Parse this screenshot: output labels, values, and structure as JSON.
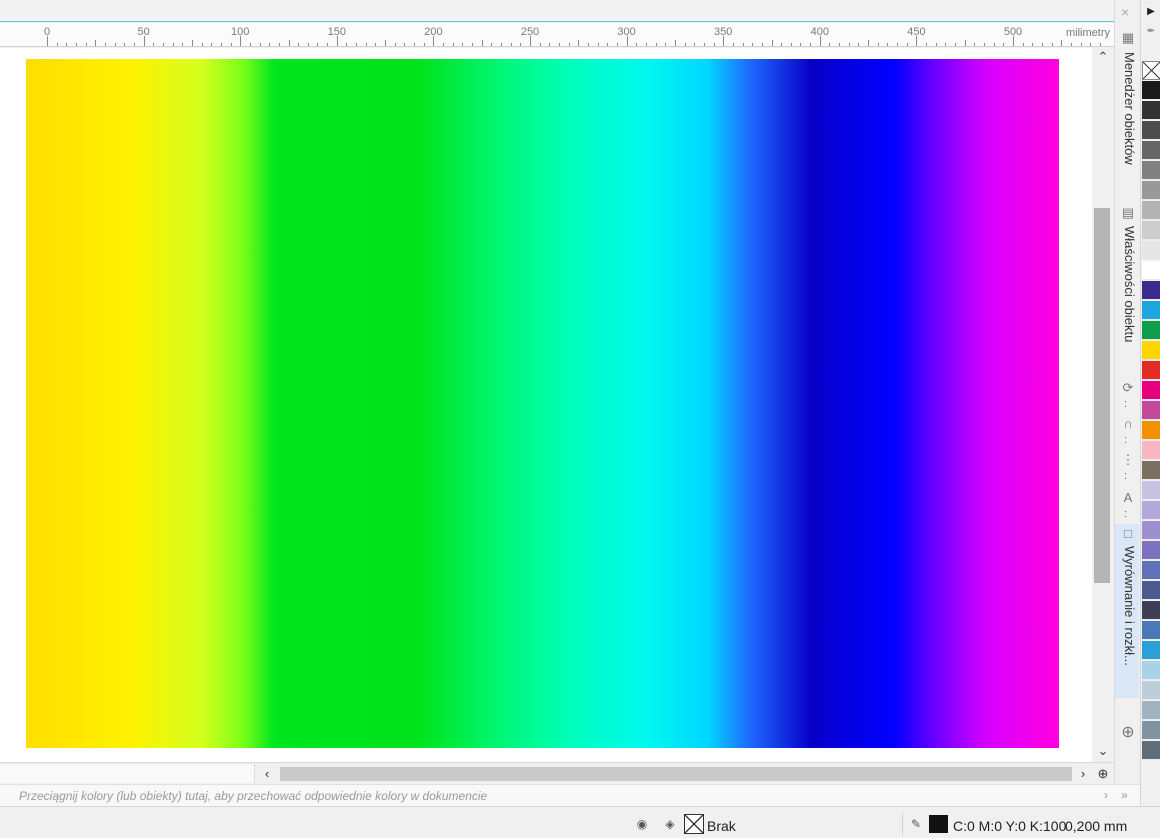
{
  "ruler": {
    "labels": [
      "0",
      "50",
      "100",
      "150",
      "200",
      "250",
      "300",
      "350",
      "400",
      "450",
      "500"
    ],
    "unit": "milimetry"
  },
  "docker": {
    "tabs": [
      "Menedżer obiektów",
      "Właściwości obiektu",
      "Wyrównanie i rozkł..."
    ],
    "icons": [
      "transform-icon",
      "shaping-icon",
      "dimension-icon",
      "text-icon",
      "align-icon",
      "add-docker-icon"
    ]
  },
  "dropzone": {
    "hint": "Przeciągnij kolory (lub obiekty) tutaj, aby przechować odpowiednie kolory w dokumencie"
  },
  "status": {
    "fill_label": "Brak",
    "outline_label": "C:0 M:0 Y:0 K:100",
    "outline_width": "0,200 mm"
  },
  "palette": {
    "colors": [
      "#1a1a1a",
      "#333333",
      "#4d4d4d",
      "#666666",
      "#808080",
      "#999999",
      "#b3b3b3",
      "#cccccc",
      "#e6e6e6",
      "#ffffff",
      "#3b2b8f",
      "#1ea6e0",
      "#0f9d4a",
      "#ffd500",
      "#e32d22",
      "#e6007e",
      "#c4489a",
      "#f39200",
      "#f7b6c2",
      "#7a6f60",
      "#c8c3e3",
      "#b4a7d9",
      "#9d8fd0",
      "#7b72c0",
      "#5f72b7",
      "#4b5a8f",
      "#3e3f56",
      "#4a79b8",
      "#2c9fd6",
      "#a9d1e8",
      "#bccfd9",
      "#9fb4c0",
      "#7f93a0",
      "#5f6e78"
    ]
  }
}
